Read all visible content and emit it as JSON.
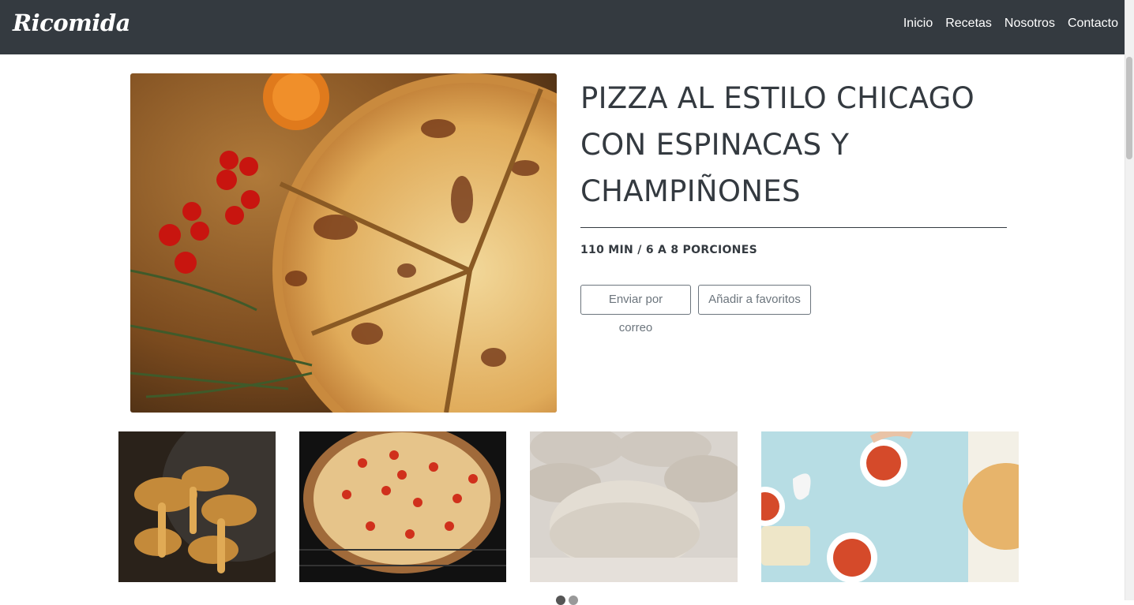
{
  "nav": {
    "brand": "Ricomida",
    "links": [
      "Inicio",
      "Recetas",
      "Nosotros",
      "Contacto"
    ]
  },
  "recipe": {
    "title_lines": [
      "PIZZA AL ESTILO CHICAGO",
      "CON ESPINACAS Y",
      "CHAMPIÑONES"
    ],
    "meta": "110 MIN / 6 A 8 PORCIONES",
    "buttons": {
      "email": "Enviar por correo",
      "favorite": "Añadir a favoritos"
    }
  },
  "gallery": {
    "images": [
      "mushrooms-photo",
      "pizza-oven-photo",
      "dough-balls-photo",
      "pizza-making-photo"
    ]
  },
  "colors": {
    "navbar": "#343a40",
    "text": "#343a40",
    "button_border": "#6c757d"
  }
}
